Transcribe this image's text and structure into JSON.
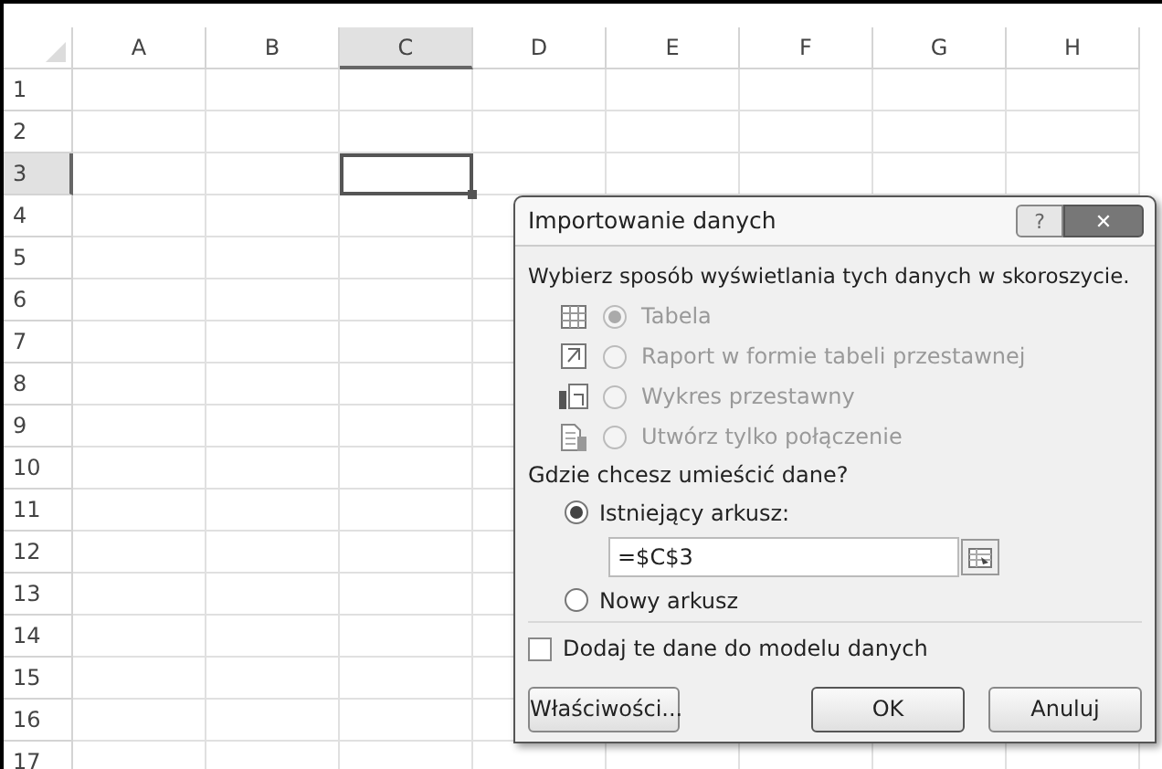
{
  "sheet": {
    "columns": [
      {
        "label": "A",
        "selected": false
      },
      {
        "label": "B",
        "selected": false
      },
      {
        "label": "C",
        "selected": true
      },
      {
        "label": "D",
        "selected": false
      },
      {
        "label": "E",
        "selected": false
      },
      {
        "label": "F",
        "selected": false
      },
      {
        "label": "G",
        "selected": false
      },
      {
        "label": "H",
        "selected": false
      }
    ],
    "rows": [
      {
        "label": "1",
        "selected": false
      },
      {
        "label": "2",
        "selected": false
      },
      {
        "label": "3",
        "selected": true
      },
      {
        "label": "4",
        "selected": false
      },
      {
        "label": "5",
        "selected": false
      },
      {
        "label": "6",
        "selected": false
      },
      {
        "label": "7",
        "selected": false
      },
      {
        "label": "8",
        "selected": false
      },
      {
        "label": "9",
        "selected": false
      },
      {
        "label": "10",
        "selected": false
      },
      {
        "label": "11",
        "selected": false
      },
      {
        "label": "12",
        "selected": false
      },
      {
        "label": "13",
        "selected": false
      },
      {
        "label": "14",
        "selected": false
      },
      {
        "label": "15",
        "selected": false
      },
      {
        "label": "16",
        "selected": false
      },
      {
        "label": "17",
        "selected": false
      }
    ]
  },
  "dialog": {
    "title": "Importowanie danych",
    "help_button": "?",
    "close_button": "✕",
    "view_prompt": "Wybierz sposób wyświetlania tych danych w skoroszycie.",
    "view_options": [
      {
        "kind": "table",
        "label": "Tabela",
        "selected": true,
        "disabled": true
      },
      {
        "kind": "pivot_table",
        "label": "Raport w formie tabeli przestawnej",
        "selected": false,
        "disabled": true
      },
      {
        "kind": "pivot_chart",
        "label": "Wykres przestawny",
        "selected": false,
        "disabled": true
      },
      {
        "kind": "connection",
        "label": "Utwórz tylko połączenie",
        "selected": false,
        "disabled": true
      }
    ],
    "place_prompt": "Gdzie chcesz umieścić dane?",
    "existing_sheet": {
      "label": "Istniejący arkusz:",
      "selected": true
    },
    "range": {
      "value": "=$C$3"
    },
    "new_sheet": {
      "label": "Nowy arkusz",
      "selected": false
    },
    "data_model": {
      "label": "Dodaj te dane do modelu danych",
      "checked": false
    },
    "buttons": [
      {
        "kind": "properties",
        "label": "Właściwości..."
      },
      {
        "kind": "ok",
        "label": "OK"
      },
      {
        "kind": "cancel",
        "label": "Anuluj"
      }
    ]
  }
}
